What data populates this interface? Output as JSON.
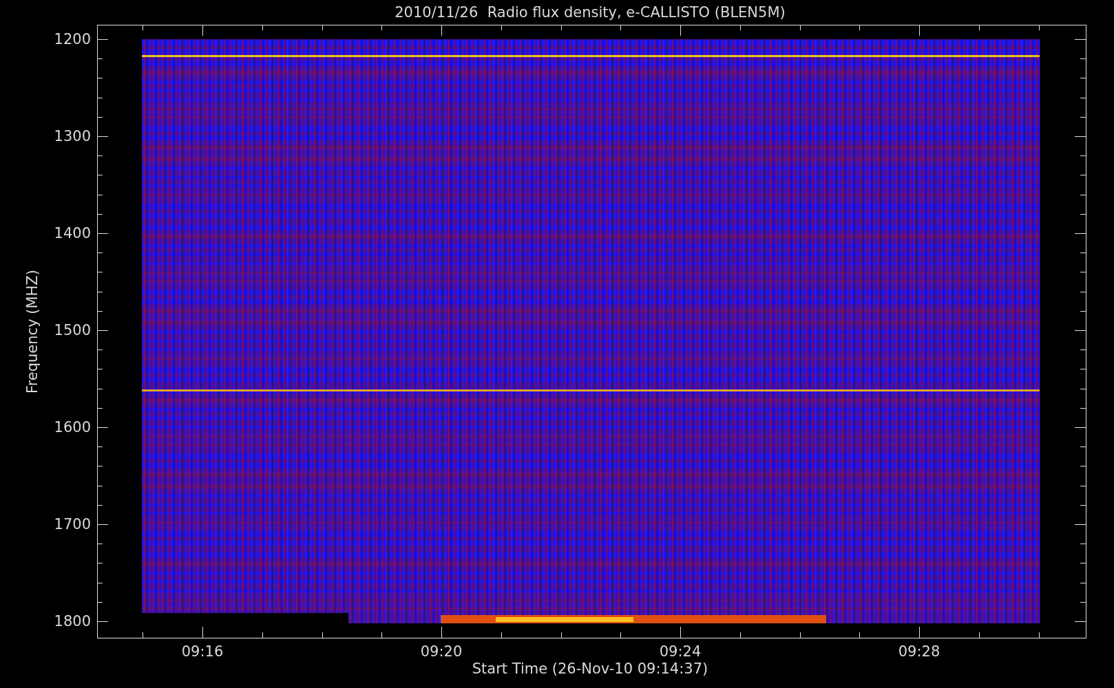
{
  "title": "2010/11/26  Radio flux density, e-CALLISTO (BLEN5M)",
  "y_axis": {
    "label": "Frequency (MHZ)",
    "tick_labels": [
      "1200",
      "1300",
      "1400",
      "1500",
      "1600",
      "1700",
      "1800"
    ]
  },
  "x_axis": {
    "label": "Start Time (26-Nov-10 09:14:37)",
    "tick_labels": [
      "09:16",
      "09:20",
      "09:24",
      "09:28"
    ]
  }
}
